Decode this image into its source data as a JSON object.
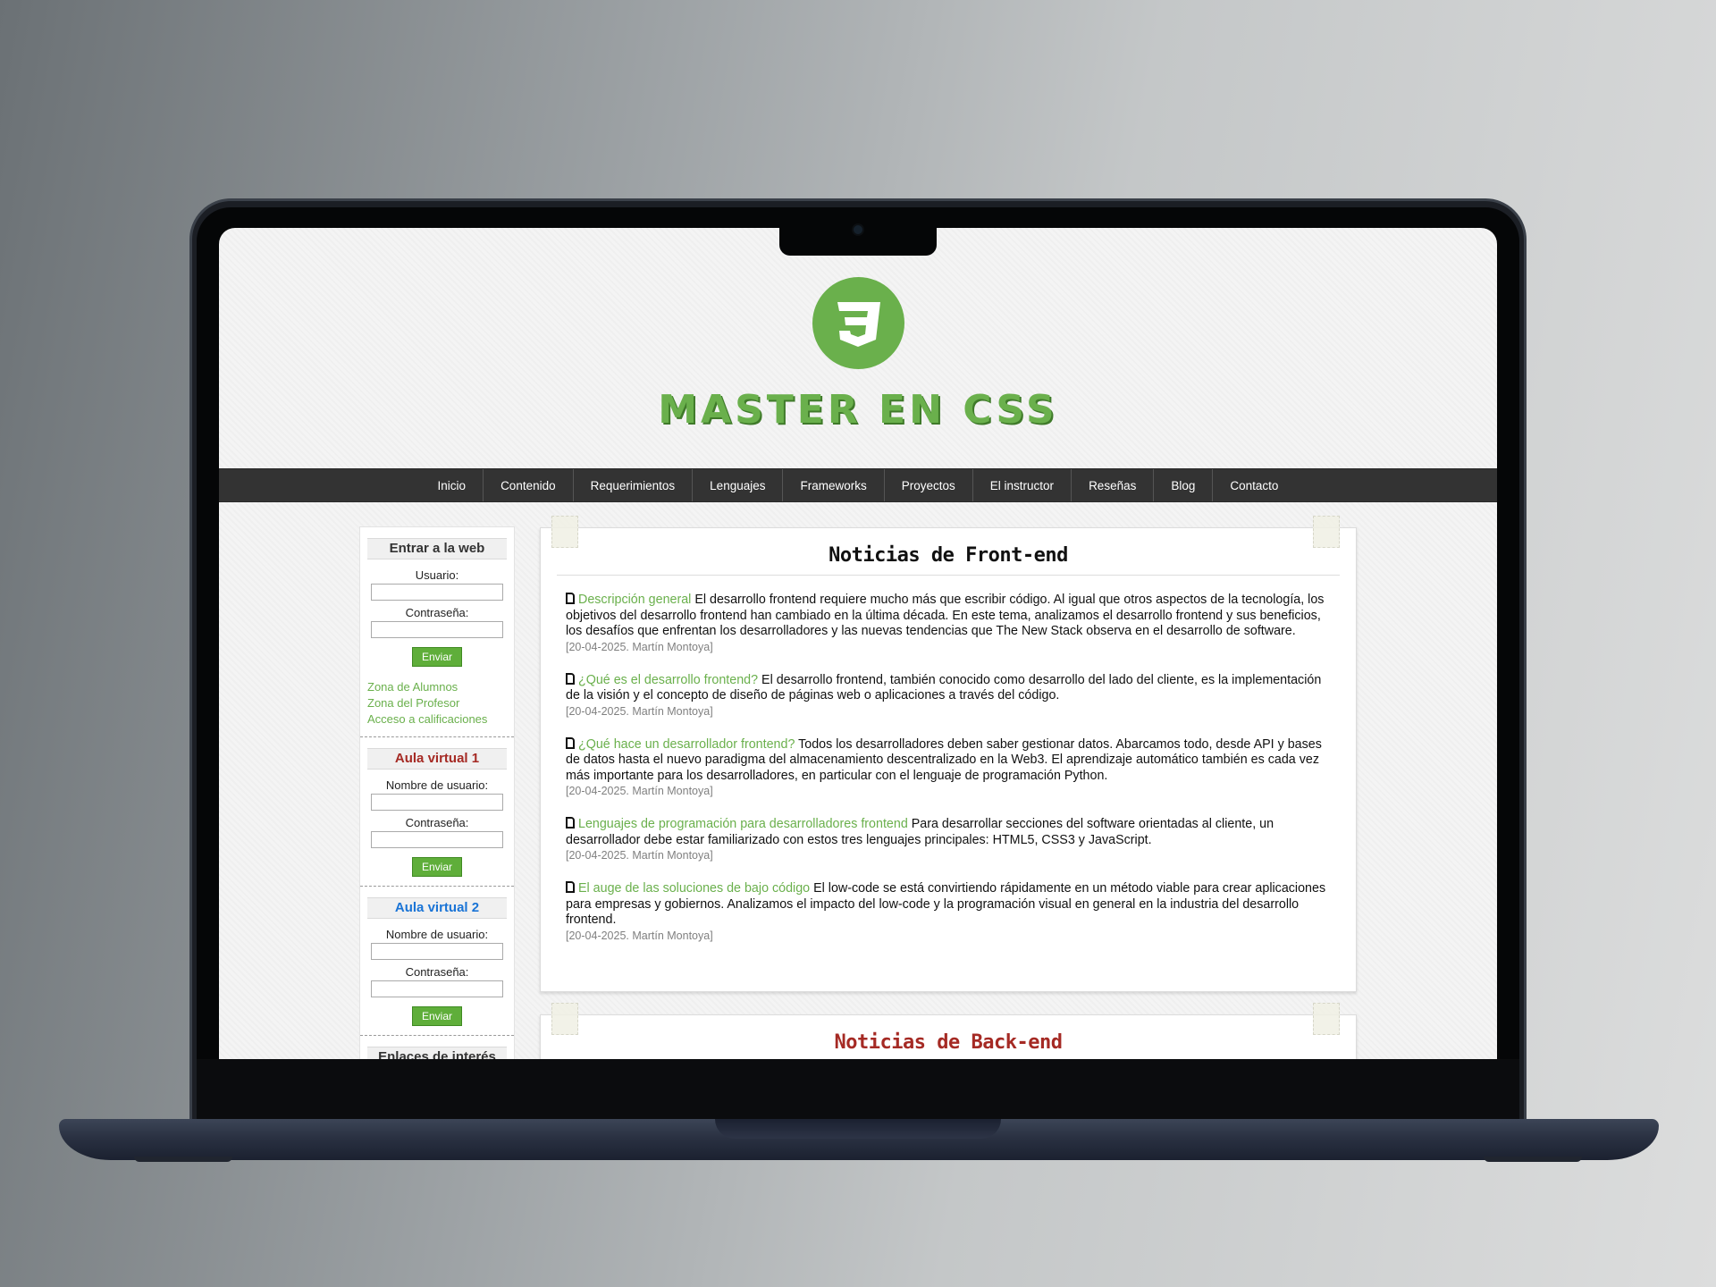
{
  "site": {
    "title": "MASTER EN CSS",
    "logo_icon": "css3-shield-icon",
    "brand_color": "#6ab04c"
  },
  "nav": {
    "items": [
      "Inicio",
      "Contenido",
      "Requerimientos",
      "Lenguajes",
      "Frameworks",
      "Proyectos",
      "El instructor",
      "Reseñas",
      "Blog",
      "Contacto"
    ]
  },
  "sidebar": {
    "login": {
      "title": "Entrar a la web",
      "user_label": "Usuario:",
      "password_label": "Contraseña:",
      "button": "Enviar",
      "links": [
        "Zona de Alumnos",
        "Zona del Profesor",
        "Acceso a calificaciones"
      ]
    },
    "aula1": {
      "title": "Aula virtual 1",
      "user_label": "Nombre de usuario:",
      "password_label": "Contraseña:",
      "button": "Enviar"
    },
    "aula2": {
      "title": "Aula virtual 2",
      "user_label": "Nombre de usuario:",
      "password_label": "Contraseña:",
      "button": "Enviar"
    },
    "interest": {
      "title": "Enlaces de interés"
    }
  },
  "front": {
    "title": "Noticias de Front-end",
    "items": [
      {
        "link": "Descripción general",
        "text": " El desarrollo frontend requiere mucho más que escribir código. Al igual que otros aspectos de la tecnología, los objetivos del desarrollo frontend han cambiado en la última década. En este tema, analizamos el desarrollo frontend y sus beneficios, los desafíos que enfrentan los desarrolladores y las nuevas tendencias que The New Stack observa en el desarrollo de software.",
        "meta": "[20-04-2025. Martín Montoya]"
      },
      {
        "link": "¿Qué es el desarrollo frontend?",
        "text": " El desarrollo frontend, también conocido como desarrollo del lado del cliente, es la implementación de la visión y el concepto de diseño de páginas web o aplicaciones a través del código.",
        "meta": "[20-04-2025. Martín Montoya]"
      },
      {
        "link": "¿Qué hace un desarrollador frontend?",
        "text": " Todos los desarrolladores deben saber gestionar datos. Abarcamos todo, desde API y bases de datos hasta el nuevo paradigma del almacenamiento descentralizado en la Web3. El aprendizaje automático también es cada vez más importante para los desarrolladores, en particular con el lenguaje de programación Python.",
        "meta": "[20-04-2025. Martín Montoya]"
      },
      {
        "link": "Lenguajes de programación para desarrolladores frontend",
        "text": " Para desarrollar secciones del software orientadas al cliente, un desarrollador debe estar familiarizado con estos tres lenguajes principales: HTML5, CSS3 y JavaScript.",
        "meta": "[20-04-2025. Martín Montoya]"
      },
      {
        "link": "El auge de las soluciones de bajo código",
        "text": " El low-code se está convirtiendo rápidamente en un método viable para crear aplicaciones para empresas y gobiernos. Analizamos el impacto del low-code y la programación visual en general en la industria del desarrollo frontend.",
        "meta": "[20-04-2025. Martín Montoya]"
      }
    ]
  },
  "back": {
    "title": "Noticias de Back-end"
  }
}
